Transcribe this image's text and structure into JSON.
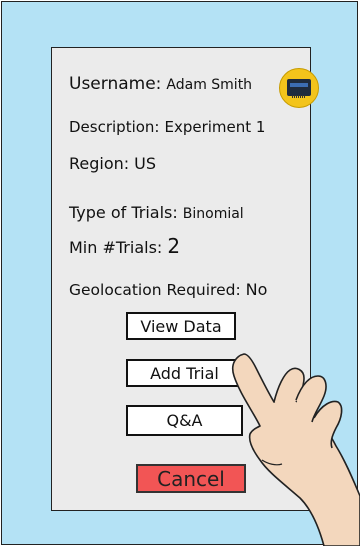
{
  "profile": {
    "username_label": "Username:",
    "username_value": "Adam Smith",
    "description_label": "Description:",
    "description_value": "Experiment 1",
    "region_label": "Region:",
    "region_value": "US",
    "trial_type_label": "Type of Trials:",
    "trial_type_value": "Binomial",
    "min_trials_label": "Min #Trials:",
    "min_trials_value": "2",
    "geolocation_label": "Geolocation Required:",
    "geolocation_value": "No"
  },
  "actions": {
    "view_data": "View Data",
    "add_trial": "Add Trial",
    "qa": "Q&A",
    "cancel": "Cancel"
  },
  "avatar_icon": "id-card-icon",
  "colors": {
    "background": "#b4e2f5",
    "card": "#ebebeb",
    "cancel": "#f25555",
    "avatar": "#f3c41b"
  }
}
